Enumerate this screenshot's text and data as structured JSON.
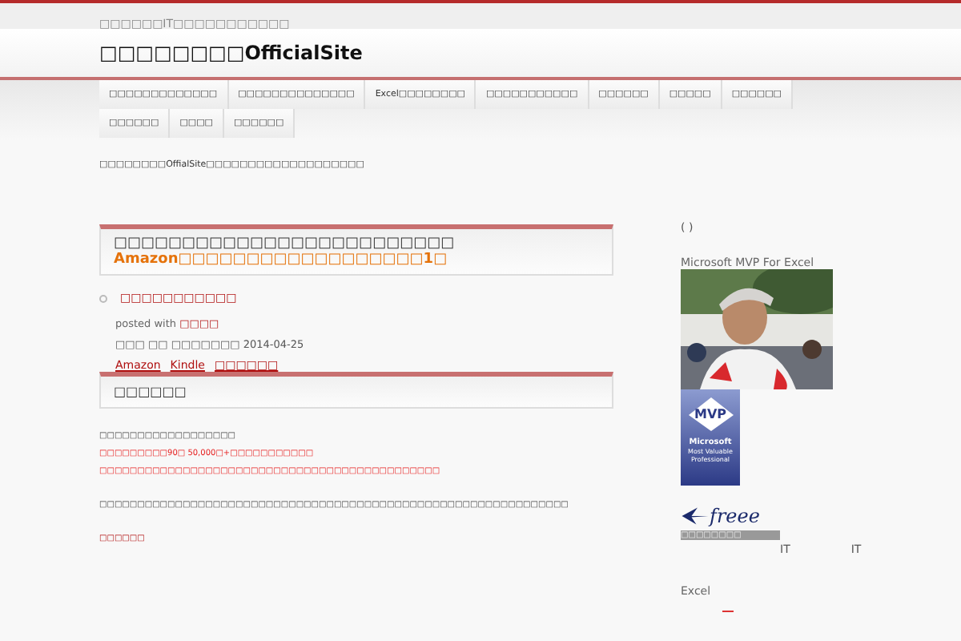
{
  "tagline": "□□□□□□IT□□□□□□□□□□□",
  "site_title": "□□□□□□□□OfficialSite",
  "nav": [
    {
      "label": "□□□□□□□□□□□□□"
    },
    {
      "label": "□□□□□□□□□□□□□□"
    },
    {
      "label": "Excel□□□□□□□□"
    },
    {
      "label": "□□□□□□□□□□□"
    },
    {
      "label": "□□□□□□"
    },
    {
      "label": "□□□□□"
    },
    {
      "label": "□□□□□□"
    },
    {
      "label": "□□□□□□"
    },
    {
      "label": "□□□□"
    },
    {
      "label": "□□□□□□"
    }
  ],
  "intro": "□□□□□□□□OffialSite□□□□□□□□□□□□□□□□□□□",
  "post": {
    "title": "□□□□□□□□□□□□□□□□□□□□□□□□□",
    "subtitle": "Amazon□□□□□□□□□□□□□□□□□□1□",
    "book_link": "□□□□□□□□□□□",
    "posted_with": "posted with",
    "posted_link": "□□□□",
    "meta": "□□□ □□ □□□□□□□ 2014-04-25",
    "store_links": [
      "Amazon",
      "Kindle",
      "□□□□□□"
    ]
  },
  "section": {
    "heading": "□□□□□□",
    "lines": [
      {
        "kind": "plain",
        "text": "□□□□□□□□□□□□□□□□□□"
      },
      {
        "kind": "red",
        "text": "□□□□□□□□□90□ 50,000□+□□□□□□□□□□□"
      },
      {
        "kind": "red",
        "text": "□□□□□□□□□□□□□□□□□□□□□□□□□□□□□□□□□□□□□□□□□□□□□"
      },
      {
        "kind": "plain",
        "text": "□□□□□□□□□□□□□□□□□□□□□□□□□□□□□□□□□□□□□□□□□□□□□□□□□□□□□□□□□□□□□□"
      },
      {
        "kind": "link",
        "text": "□□□□□□"
      }
    ]
  },
  "sidebar": {
    "parens": "( )",
    "mvp_heading": "Microsoft MVP For Excel",
    "badge": {
      "abbr": "MVP",
      "line1": "Microsoft",
      "line2": "Most Valuable",
      "line3": "Professional"
    },
    "freee": {
      "logo": "freee",
      "caption": "□□□□□□□□"
    },
    "it_labels": [
      "IT",
      "IT"
    ],
    "excel": "Excel"
  }
}
